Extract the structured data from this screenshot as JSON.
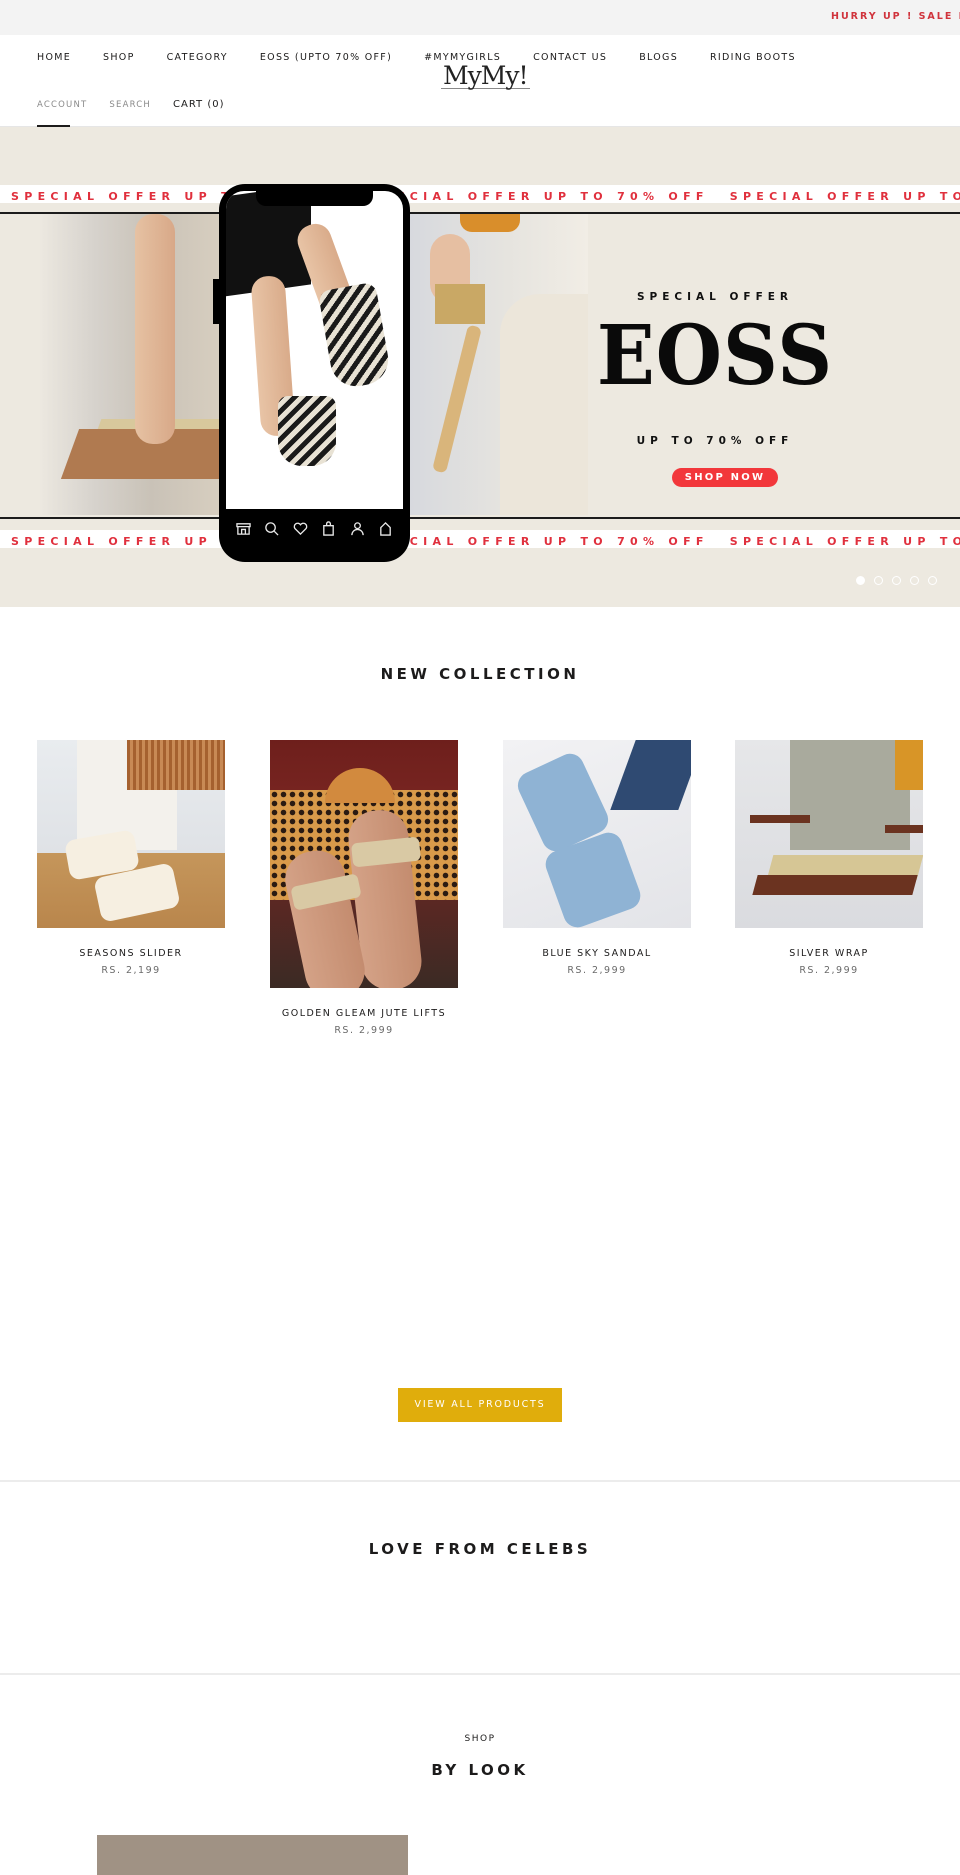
{
  "announcement": {
    "text": "HURRY UP ! SALE EN"
  },
  "header": {
    "nav": [
      {
        "label": "HOME"
      },
      {
        "label": "SHOP"
      },
      {
        "label": "CATEGORY"
      },
      {
        "label": "EOSS (UPTO 70% OFF)"
      },
      {
        "label": "#MYMYGIRLS"
      },
      {
        "label": "CONTACT US"
      },
      {
        "label": "BLOGS"
      },
      {
        "label": "RIDING BOOTS"
      }
    ],
    "logo": "MyMy!",
    "account_label": "ACCOUNT",
    "search_label": "SEARCH",
    "cart_label": "CART (0)"
  },
  "hero": {
    "ticker_text": "SPECIAL OFFER UP TO 70% OFF",
    "kicker": "SPECIAL OFFER",
    "title": "EOSS",
    "subtitle": "UP TO 70% OFF",
    "button_label": "SHOP NOW",
    "accent_color": "#f2373b",
    "slides_total": 5,
    "active_slide": 1,
    "phone_dock_icons": [
      "store-icon",
      "search-icon",
      "heart-icon",
      "shopping-bag-icon",
      "user-icon",
      "home-icon"
    ]
  },
  "new_collection": {
    "title": "NEW COLLECTION",
    "products": [
      {
        "name": "SEASONS SLIDER",
        "price": "RS. 2,199"
      },
      {
        "name": "GOLDEN GLEAM JUTE LIFTS",
        "price": "RS. 2,999"
      },
      {
        "name": "BLUE SKY SANDAL",
        "price": "RS. 2,999"
      },
      {
        "name": "SILVER WRAP",
        "price": "RS. 2,999"
      }
    ],
    "view_all_label": "VIEW ALL PRODUCTS",
    "button_color": "#e0ad0c"
  },
  "celebs": {
    "title": "LOVE FROM CELEBS"
  },
  "shop_by_look": {
    "kicker": "SHOP",
    "title": "BY LOOK"
  }
}
